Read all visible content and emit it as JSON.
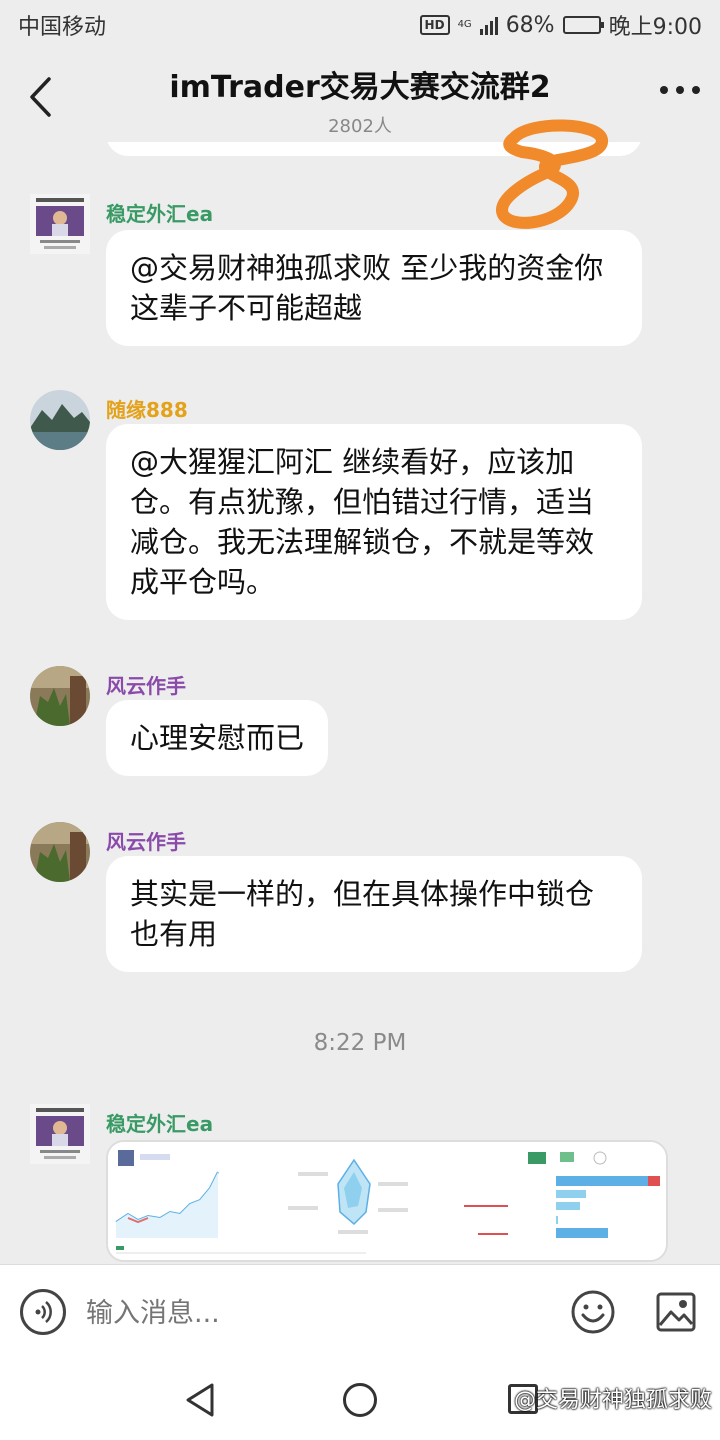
{
  "status_bar": {
    "carrier": "中国移动",
    "hd": "HD",
    "network": "4G",
    "battery": "68%",
    "battery_level": 0.68,
    "time": "晚上9:00"
  },
  "header": {
    "title": "imTrader交易大赛交流群2",
    "member_count": "2802人"
  },
  "colors": {
    "green_name": "#3a9a66",
    "gold_name": "#e3a21a",
    "purple_name": "#8a4aaa",
    "annotation_orange": "#f08a2a"
  },
  "messages": [
    {
      "sender": "稳定外汇ea",
      "text": "@交易财神独孤求败 至少我的资金你这辈子不可能超越"
    },
    {
      "sender": "随缘888",
      "text": "@大猩猩汇阿汇 继续看好，应该加仓。有点犹豫，但怕错过行情，适当减仓。我无法理解锁仓，不就是等效成平仓吗。"
    },
    {
      "sender": "风云作手",
      "text": "心理安慰而已"
    },
    {
      "sender": "风云作手",
      "text": "其实是一样的，但在具体操作中锁仓也有用"
    }
  ],
  "timestamp": "8:22 PM",
  "image_message": {
    "sender": "稳定外汇ea"
  },
  "input": {
    "placeholder": "输入消息..."
  },
  "watermark": "@交易财神独孤求败"
}
